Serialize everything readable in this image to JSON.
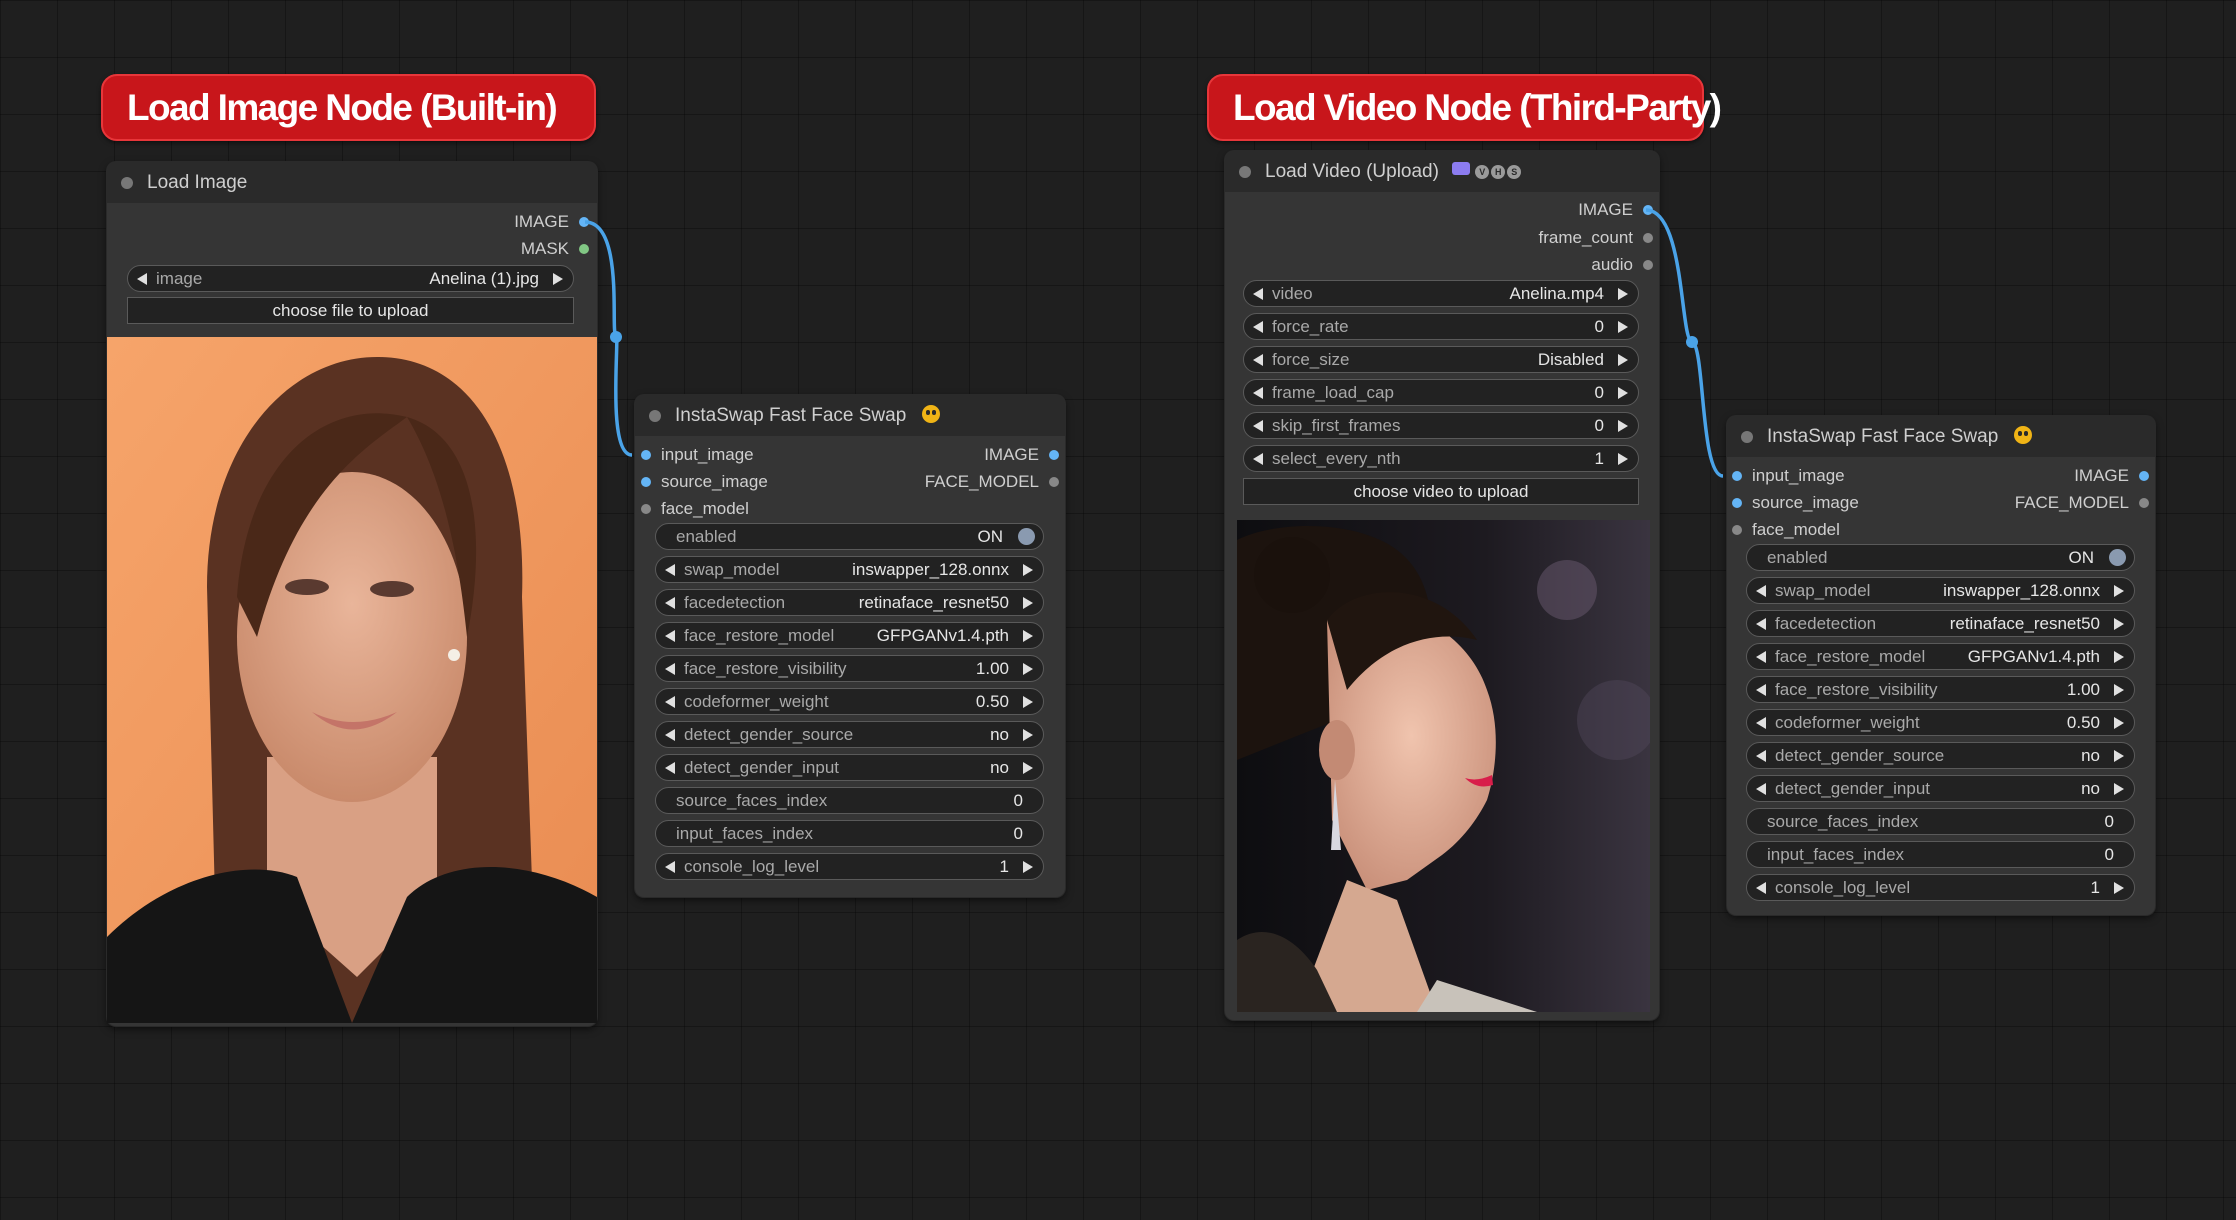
{
  "groups": {
    "left_title": "Load Image Node (Built-in)",
    "right_title": "Load Video Node (Third-Party)"
  },
  "load_image": {
    "title": "Load Image",
    "outputs": [
      "IMAGE",
      "MASK"
    ],
    "image_label": "image",
    "image_value": "Anelina (1).jpg",
    "upload_label": "choose file to upload"
  },
  "load_video": {
    "title": "Load Video (Upload)",
    "outputs": [
      "IMAGE",
      "frame_count",
      "audio"
    ],
    "widgets": [
      {
        "label": "video",
        "value": "Anelina.mp4"
      },
      {
        "label": "force_rate",
        "value": "0"
      },
      {
        "label": "force_size",
        "value": "Disabled"
      },
      {
        "label": "frame_load_cap",
        "value": "0"
      },
      {
        "label": "skip_first_frames",
        "value": "0"
      },
      {
        "label": "select_every_nth",
        "value": "1"
      }
    ],
    "upload_label": "choose video to upload"
  },
  "faceswap": {
    "title": "InstaSwap Fast Face Swap",
    "inputs": [
      "input_image",
      "source_image",
      "face_model"
    ],
    "outputs": [
      "IMAGE",
      "FACE_MODEL"
    ],
    "enabled_label": "enabled",
    "enabled_value": "ON",
    "widgets": [
      {
        "label": "swap_model",
        "value": "inswapper_128.onnx"
      },
      {
        "label": "facedetection",
        "value": "retinaface_resnet50"
      },
      {
        "label": "face_restore_model",
        "value": "GFPGANv1.4.pth"
      },
      {
        "label": "face_restore_visibility",
        "value": "1.00"
      },
      {
        "label": "codeformer_weight",
        "value": "0.50"
      },
      {
        "label": "detect_gender_source",
        "value": "no"
      },
      {
        "label": "detect_gender_input",
        "value": "no"
      }
    ],
    "plain_widgets": [
      {
        "label": "source_faces_index",
        "value": "0"
      },
      {
        "label": "input_faces_index",
        "value": "0"
      }
    ],
    "log_widget": {
      "label": "console_log_level",
      "value": "1"
    }
  },
  "colors": {
    "group_red": "#c8161b",
    "link_blue": "#4aa3e8",
    "image_slot": "#64b5f6",
    "mask_slot": "#81c784",
    "gray_slot": "#888888"
  }
}
